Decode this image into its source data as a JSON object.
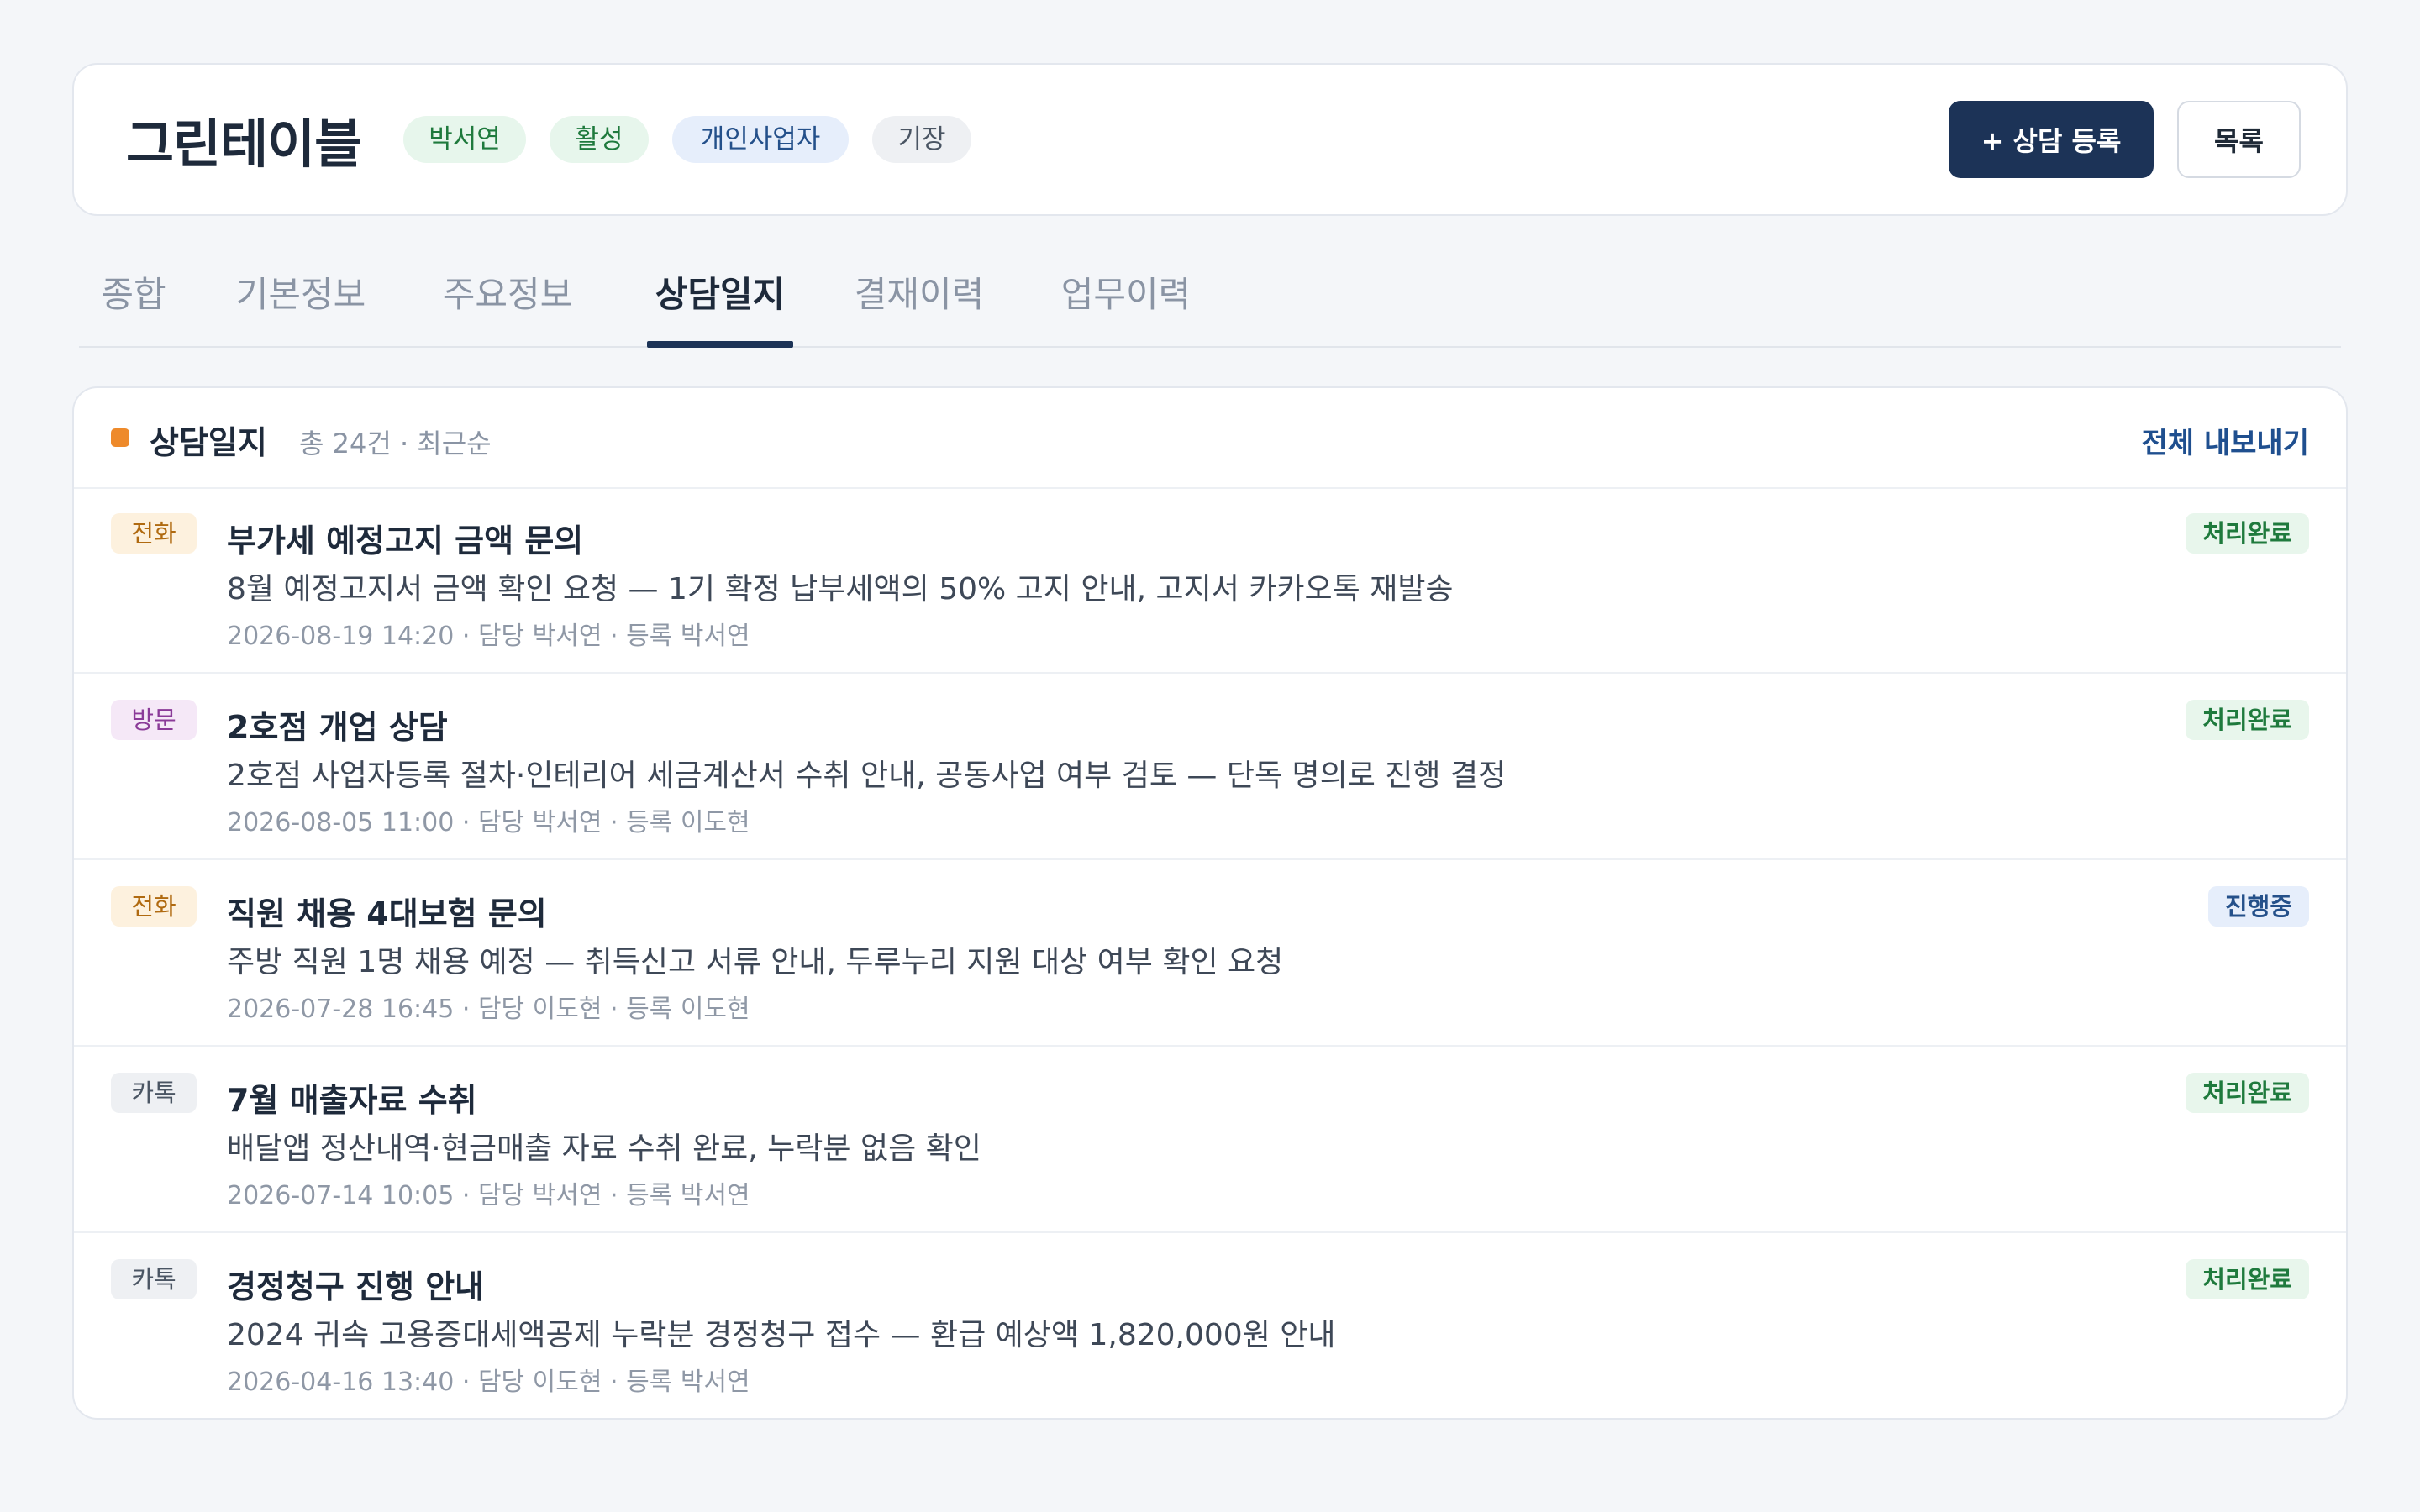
{
  "header": {
    "client_name": "그린테이블",
    "badges": [
      {
        "label": "박서연",
        "color": "#1f7a3d"
      },
      {
        "label": "활성",
        "color": "#1f7a3d"
      },
      {
        "label": "개인사업자",
        "color": "#24508a"
      },
      {
        "label": "기장",
        "color": "#4a5563"
      }
    ],
    "add_consult_label": "+ 상담 등록",
    "list_label": "목록"
  },
  "tabs": [
    {
      "label": "종합",
      "active": false
    },
    {
      "label": "기본정보",
      "active": false
    },
    {
      "label": "주요정보",
      "active": false
    },
    {
      "label": "상담일지",
      "active": true
    },
    {
      "label": "결재이력",
      "active": false
    },
    {
      "label": "업무이력",
      "active": false
    }
  ],
  "log": {
    "title": "상담일지",
    "meta": "총 24건 · 최근순",
    "export_label": "전체 내보내기",
    "accent_color": "#ee8a2b",
    "entries": [
      {
        "type": "전화",
        "title": "부가세 예정고지 금액 문의",
        "desc": "8월 예정고지서 금액 확인 요청 — 1기 확정 납부세액의 50% 고지 안내, 고지서 카카오톡 재발송",
        "meta": "2026-08-19 14:20 · 담당 박서연 · 등록 박서연",
        "status": "처리완료"
      },
      {
        "type": "방문",
        "title": "2호점 개업 상담",
        "desc": "2호점 사업자등록 절차·인테리어 세금계산서 수취 안내, 공동사업 여부 검토 — 단독 명의로 진행 결정",
        "meta": "2026-08-05 11:00 · 담당 박서연 · 등록 이도현",
        "status": "처리완료"
      },
      {
        "type": "전화",
        "title": "직원 채용 4대보험 문의",
        "desc": "주방 직원 1명 채용 예정 — 취득신고 서류 안내, 두루누리 지원 대상 여부 확인 요청",
        "meta": "2026-07-28 16:45 · 담당 이도현 · 등록 이도현",
        "status": "진행중"
      },
      {
        "type": "카톡",
        "title": "7월 매출자료 수취",
        "desc": "배달앱 정산내역·현금매출 자료 수취 완료, 누락분 없음 확인",
        "meta": "2026-07-14 10:05 · 담당 박서연 · 등록 박서연",
        "status": "처리완료"
      },
      {
        "type": "카톡",
        "title": "경정청구 진행 안내",
        "desc": "2024 귀속 고용증대세액공제 누락분 경정청구 접수 — 환급 예상액 1,820,000원 안내",
        "meta": "2026-04-16 13:40 · 담당 이도현 · 등록 박서연",
        "status": "처리완료"
      }
    ]
  }
}
